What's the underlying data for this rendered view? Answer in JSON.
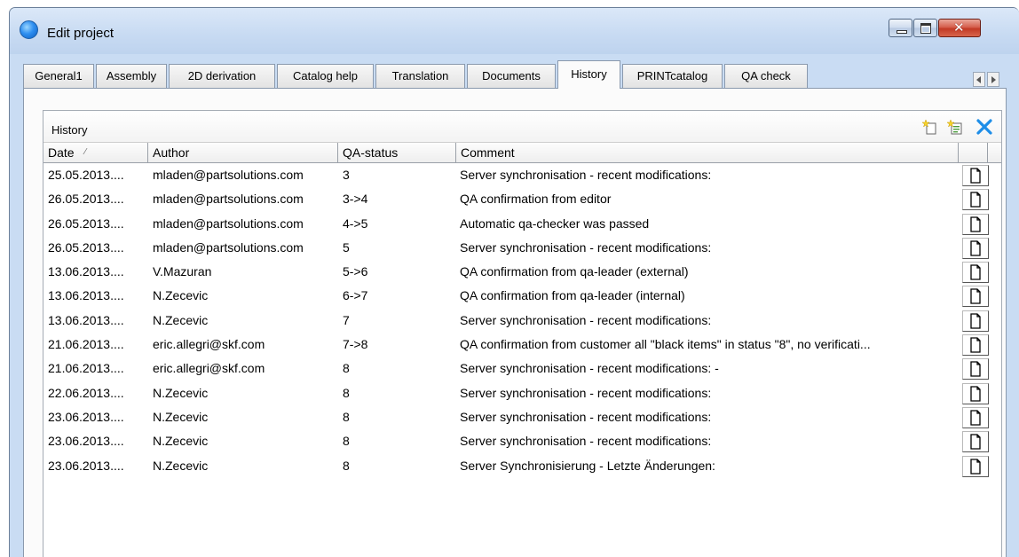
{
  "window": {
    "title": "Edit project"
  },
  "tabs": [
    {
      "label": "General1"
    },
    {
      "label": "Assembly"
    },
    {
      "label": "2D derivation"
    },
    {
      "label": "Catalog help"
    },
    {
      "label": "Translation"
    },
    {
      "label": "Documents"
    },
    {
      "label": "History",
      "active": true
    },
    {
      "label": "PRINTcatalog"
    },
    {
      "label": "QA check"
    }
  ],
  "panel": {
    "title": "History",
    "toolbar_icons": [
      "new-entry-icon",
      "import-entry-icon",
      "delete-icon"
    ],
    "columns": {
      "date": "Date",
      "author": "Author",
      "qa": "QA-status",
      "comment": "Comment"
    },
    "rows": [
      {
        "date": "25.05.2013....",
        "author": "mladen@partsolutions.com",
        "qa": "3",
        "comment": "Server synchronisation - recent modifications:"
      },
      {
        "date": "26.05.2013....",
        "author": "mladen@partsolutions.com",
        "qa": "3->4",
        "comment": "QA confirmation from editor"
      },
      {
        "date": "26.05.2013....",
        "author": "mladen@partsolutions.com",
        "qa": "4->5",
        "comment": "Automatic qa-checker was passed"
      },
      {
        "date": "26.05.2013....",
        "author": "mladen@partsolutions.com",
        "qa": "5",
        "comment": "Server synchronisation - recent modifications:"
      },
      {
        "date": "13.06.2013....",
        "author": "V.Mazuran",
        "qa": "5->6",
        "comment": "QA confirmation from qa-leader (external)"
      },
      {
        "date": "13.06.2013....",
        "author": "N.Zecevic",
        "qa": "6->7",
        "comment": "QA confirmation from qa-leader (internal)"
      },
      {
        "date": "13.06.2013....",
        "author": "N.Zecevic",
        "qa": "7",
        "comment": "Server synchronisation - recent modifications:"
      },
      {
        "date": "21.06.2013....",
        "author": "eric.allegri@skf.com",
        "qa": "7->8",
        "comment": "QA confirmation from customer all \"black items\" in status \"8\", no verificati..."
      },
      {
        "date": "21.06.2013....",
        "author": "eric.allegri@skf.com",
        "qa": "8",
        "comment": "Server synchronisation - recent modifications: -"
      },
      {
        "date": "22.06.2013....",
        "author": "N.Zecevic",
        "qa": "8",
        "comment": "Server synchronisation - recent modifications:"
      },
      {
        "date": "23.06.2013....",
        "author": "N.Zecevic",
        "qa": "8",
        "comment": "Server synchronisation - recent modifications:"
      },
      {
        "date": "23.06.2013....",
        "author": "N.Zecevic",
        "qa": "8",
        "comment": "Server synchronisation - recent modifications:"
      },
      {
        "date": "23.06.2013....",
        "author": "N.Zecevic",
        "qa": "8",
        "comment": "Server Synchronisierung - Letzte Änderungen:"
      }
    ]
  },
  "colors": {
    "accent": "#1e8ee8",
    "titlebar": "#c9dcf3",
    "close": "#c23a25"
  }
}
